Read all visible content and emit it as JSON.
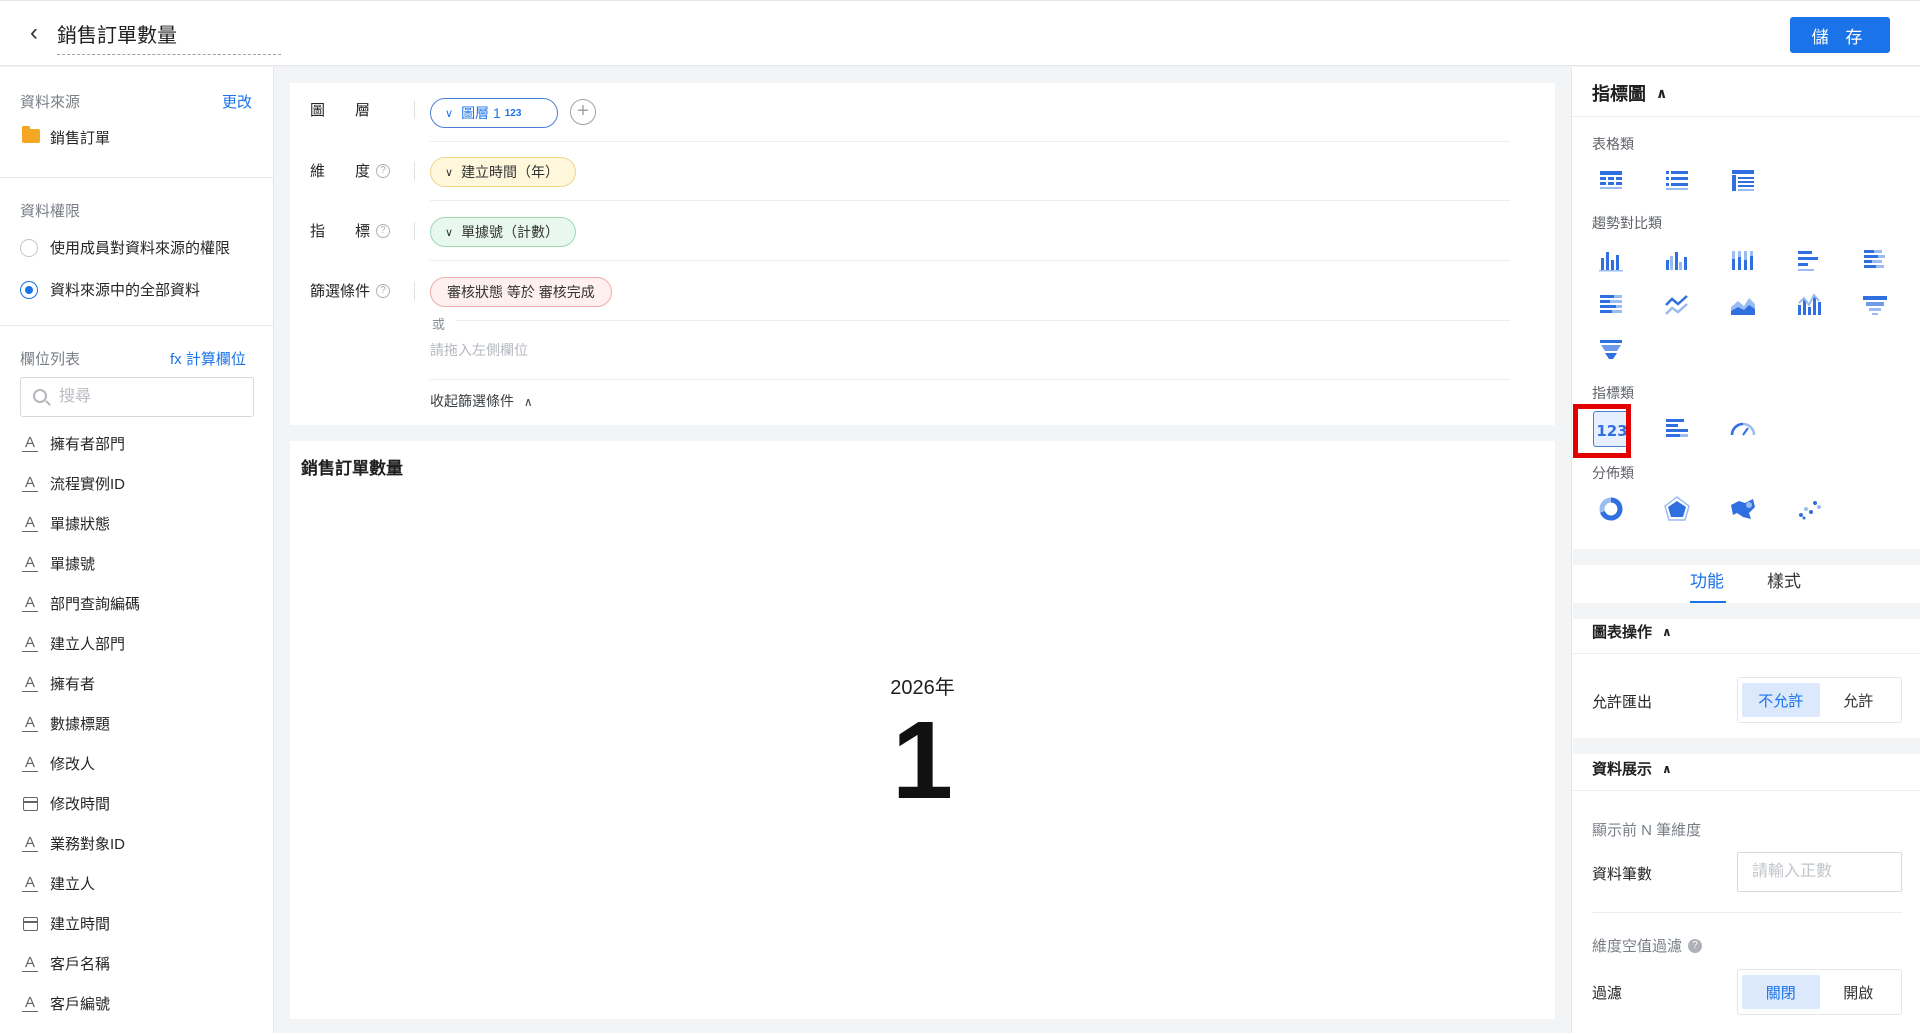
{
  "header": {
    "title": "銷售訂單數量",
    "save_label": "儲 存"
  },
  "sidebar": {
    "datasource_label": "資料來源",
    "change_link": "更改",
    "datasource_name": "銷售訂單",
    "permission_label": "資料權限",
    "permission_options": [
      {
        "label": "使用成員對資料來源的權限",
        "selected": false
      },
      {
        "label": "資料來源中的全部資料",
        "selected": true
      }
    ],
    "fields_label": "欄位列表",
    "calc_field_link": "fx 計算欄位",
    "search_placeholder": "搜尋",
    "fields": [
      {
        "label": "擁有者部門",
        "type": "text"
      },
      {
        "label": "流程實例ID",
        "type": "text"
      },
      {
        "label": "單據狀態",
        "type": "text"
      },
      {
        "label": "單據號",
        "type": "text"
      },
      {
        "label": "部門查詢編碼",
        "type": "text"
      },
      {
        "label": "建立人部門",
        "type": "text"
      },
      {
        "label": "擁有者",
        "type": "text"
      },
      {
        "label": "數據標題",
        "type": "text"
      },
      {
        "label": "修改人",
        "type": "text"
      },
      {
        "label": "修改時間",
        "type": "date"
      },
      {
        "label": "業務對象ID",
        "type": "text"
      },
      {
        "label": "建立人",
        "type": "text"
      },
      {
        "label": "建立時間",
        "type": "date"
      },
      {
        "label": "客戶名稱",
        "type": "text"
      },
      {
        "label": "客戶編號",
        "type": "text"
      }
    ]
  },
  "config": {
    "layer_label": "圖　　層",
    "layer_chip": "圖層 1",
    "layer_chip_badge": "123",
    "dimension_label": "維　　度",
    "dimension_chip": "建立時間（年）",
    "metric_label": "指　　標",
    "metric_chip": "單據號（計數）",
    "filter_label": "篩選條件",
    "filter_chip": "審核狀態 等於 審核完成",
    "or_text": "或",
    "drag_hint": "請拖入左側欄位",
    "collapse_link": "收起篩選條件"
  },
  "chart": {
    "title": "銷售訂單數量",
    "subtitle": "2026年",
    "value": "1"
  },
  "right_panel": {
    "header": "指標圖",
    "categories": {
      "table": "表格類",
      "trend": "趨勢對比類",
      "metric": "指標類",
      "distribution": "分佈類"
    },
    "tabs": [
      "功能",
      "樣式"
    ],
    "active_tab": 0,
    "chart_ops": {
      "header": "圖表操作",
      "allow_export_label": "允許匯出",
      "options": [
        "不允許",
        "允許"
      ],
      "selected": 0
    },
    "data_display": {
      "header": "資料展示",
      "topn_label": "顯示前 N 筆維度",
      "count_label": "資料筆數",
      "count_placeholder": "請輸入正數",
      "null_filter_label": "維度空值過濾",
      "filter_label": "過濾",
      "filter_options": [
        "關閉",
        "開啟"
      ],
      "filter_selected": 0
    },
    "colors": {
      "accent": "#1a73e8",
      "highlight_frame": "#e30000"
    }
  }
}
